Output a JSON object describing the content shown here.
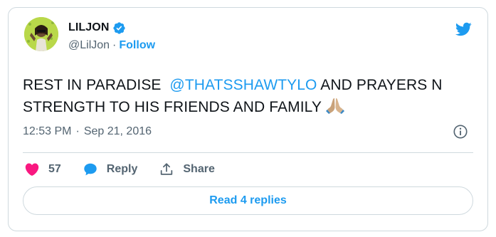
{
  "author": {
    "display_name": "LILJON",
    "handle": "@LilJon",
    "separator": "·",
    "follow_label": "Follow"
  },
  "tweet": {
    "text_before": "REST IN PARADISE  ",
    "mention": "@THATSSHAWTYLO",
    "text_after": " AND PRAYERS N STRENGTH TO HIS FRIENDS AND FAMILY",
    "emoji_name": "folded-hands"
  },
  "meta": {
    "time": "12:53 PM",
    "separator": "·",
    "date": "Sep 21, 2016"
  },
  "actions": {
    "like_count": "57",
    "reply_label": "Reply",
    "share_label": "Share"
  },
  "replies_button": {
    "label": "Read 4 replies"
  },
  "colors": {
    "accent": "#1d9bf0",
    "like": "#f91880",
    "text": "#0f1419",
    "muted": "#536471",
    "border": "#cfd9de"
  }
}
